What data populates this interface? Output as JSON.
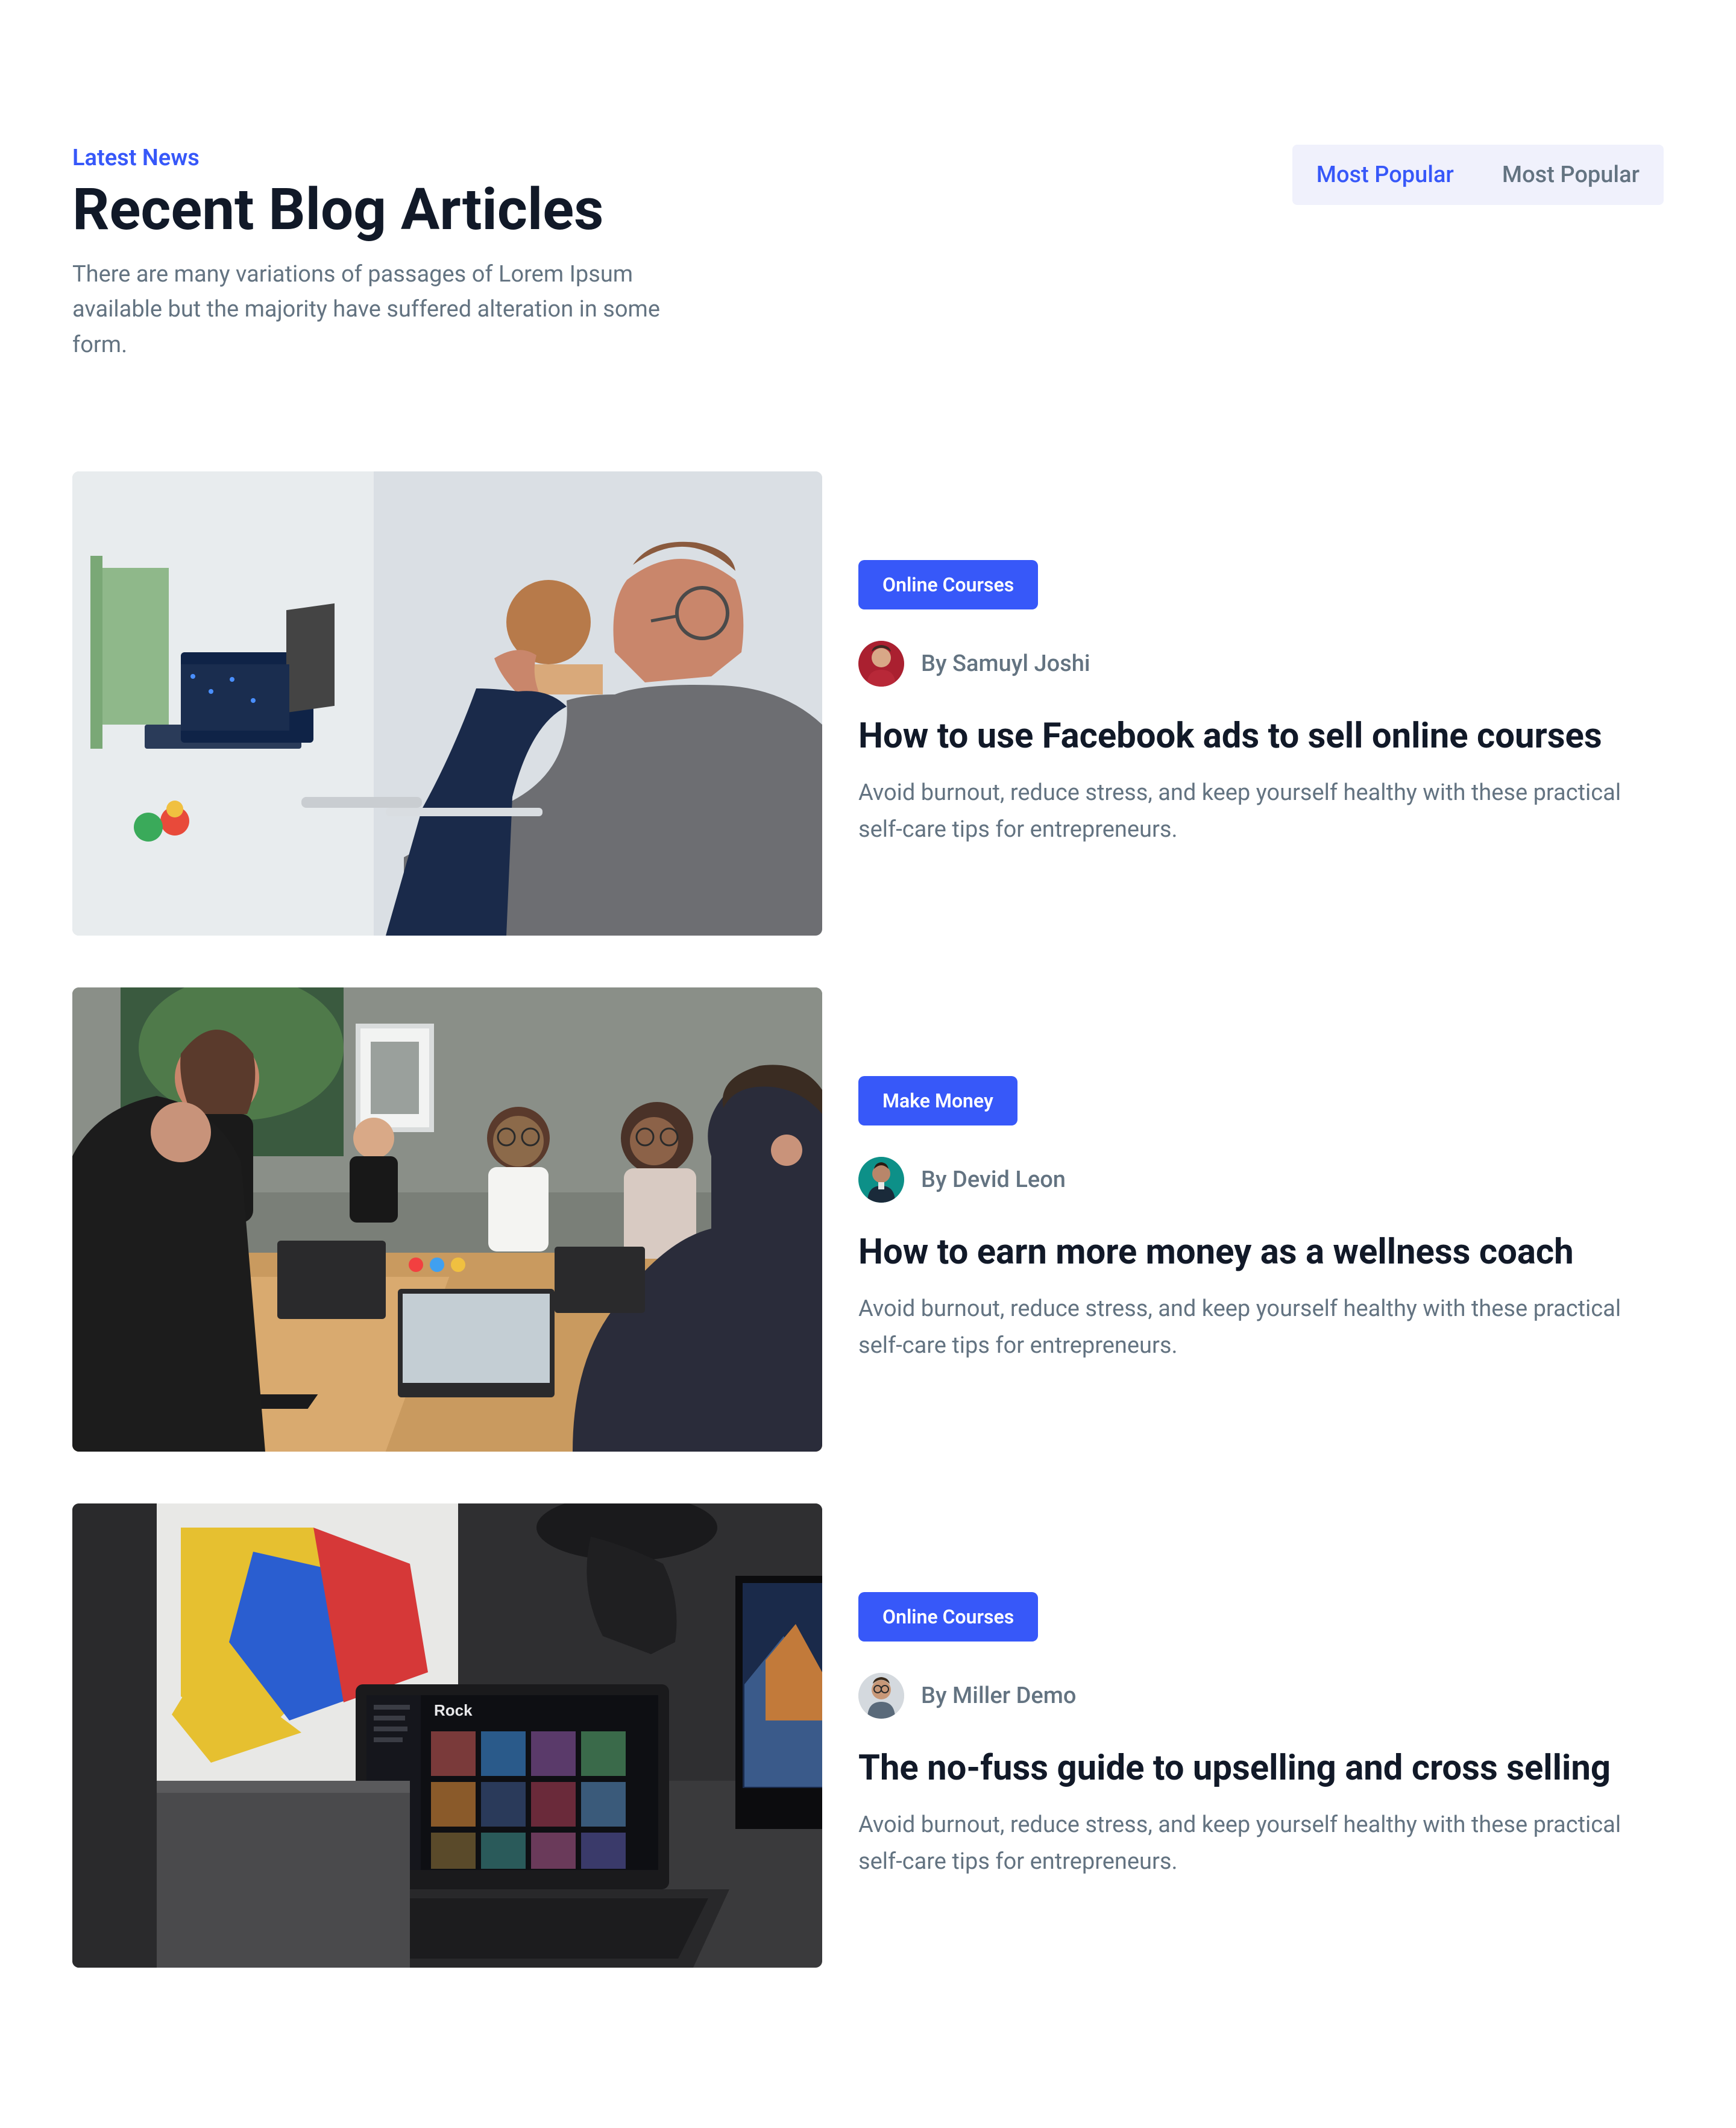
{
  "overline": "Latest News",
  "title": "Recent Blog Articles",
  "subtitle": "There are many variations of passages of Lorem Ipsum available but the majority have suffered alteration in some form.",
  "tabs": [
    {
      "label": "Most Popular",
      "active": true
    },
    {
      "label": "Most Popular",
      "active": false
    }
  ],
  "posts": [
    {
      "category": "Online Courses",
      "author_prefix": "By ",
      "author": "Samuyl Joshi",
      "title": "How to use Facebook ads to sell online courses",
      "excerpt": "Avoid burnout, reduce stress, and keep yourself healthy with these practical self-care tips for entrepreneurs."
    },
    {
      "category": "Make Money",
      "author_prefix": "By ",
      "author": "Devid Leon",
      "title": "How to earn more money as a wellness coach",
      "excerpt": "Avoid burnout, reduce stress, and keep yourself healthy with these practical self-care tips for entrepreneurs."
    },
    {
      "category": "Online Courses",
      "author_prefix": "By ",
      "author": "Miller Demo",
      "title": "The no-fuss guide to upselling and cross selling",
      "excerpt": "Avoid burnout, reduce stress, and keep yourself healthy with these practical self-care tips for entrepreneurs."
    }
  ]
}
